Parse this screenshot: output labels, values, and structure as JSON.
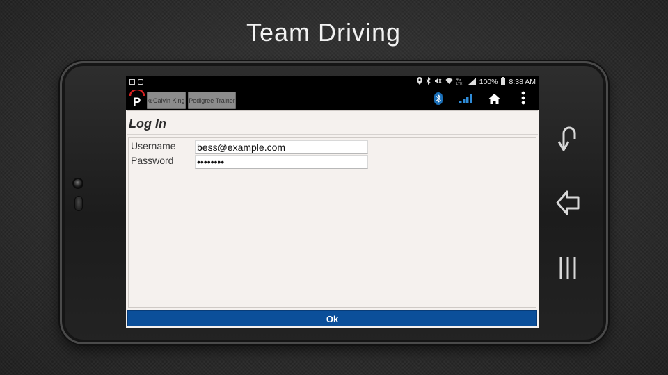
{
  "slide": {
    "title": "Team Driving"
  },
  "statusbar": {
    "battery": "100%",
    "time": "8:38 AM",
    "network": "4G LTE"
  },
  "appbar": {
    "tabs": [
      {
        "label": "⊕Calvin King"
      },
      {
        "label": "Pedigree Trainer"
      }
    ]
  },
  "page": {
    "title": "Log In"
  },
  "form": {
    "username_label": "Username",
    "username_value": "bess@example.com",
    "password_label": "Password",
    "password_value": "••••••••"
  },
  "footer": {
    "ok_label": "Ok"
  },
  "colors": {
    "accent": "#0b4f9a",
    "background": "#f5f1ee"
  }
}
